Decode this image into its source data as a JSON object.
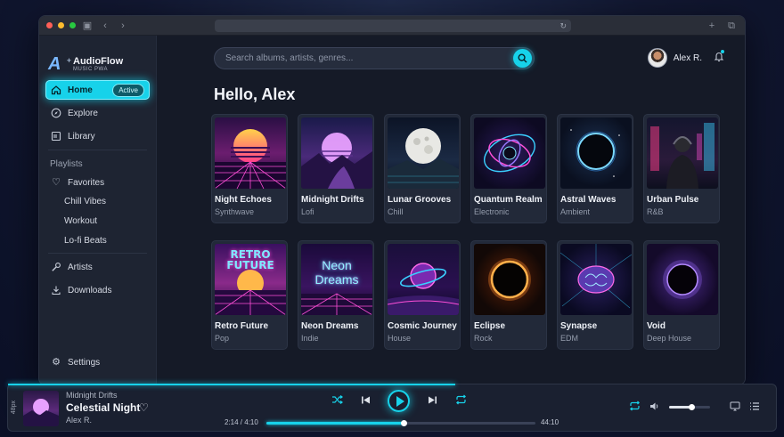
{
  "app": {
    "brand_name": "AudioFlow",
    "brand_sub": "MUSIC PWA",
    "accent_color": "#17d2ea"
  },
  "sidebar": {
    "nav": [
      {
        "label": "Home",
        "icon": "home-icon",
        "badge": "Active"
      },
      {
        "label": "Explore",
        "icon": "compass-icon"
      },
      {
        "label": "Library",
        "icon": "library-icon"
      }
    ],
    "playlists_label": "Playlists",
    "favorites_label": "Favorites",
    "playlists": [
      "Chill Vibes",
      "Workout",
      "Lo-fi Beats"
    ],
    "artists_label": "Artists",
    "downloads_label": "Downloads",
    "settings_label": "Settings"
  },
  "header": {
    "search_placeholder": "Search albums, artists, genres...",
    "user_name": "Alex R.",
    "greeting": "Hello, Alex"
  },
  "albums": [
    {
      "title": "Night Echoes",
      "genre": "Synthwave"
    },
    {
      "title": "Midnight Drifts",
      "genre": "Lofi"
    },
    {
      "title": "Lunar Grooves",
      "genre": "Chill"
    },
    {
      "title": "Quantum Realm",
      "genre": "Electronic"
    },
    {
      "title": "Astral Waves",
      "genre": "Ambient"
    },
    {
      "title": "Urban Pulse",
      "genre": "R&B"
    },
    {
      "title": "Retro Future",
      "genre": "Pop",
      "art_text": [
        "RETRO",
        "FUTURE"
      ]
    },
    {
      "title": "Neon Dreams",
      "genre": "Indie",
      "art_text": [
        "Neon",
        "Dreams"
      ]
    },
    {
      "title": "Cosmic Journey",
      "genre": "House"
    },
    {
      "title": "Eclipse",
      "genre": "Rock"
    },
    {
      "title": "Synapse",
      "genre": "EDM"
    },
    {
      "title": "Void",
      "genre": "Deep House"
    }
  ],
  "player": {
    "side_tag": "48px",
    "album": "Midnight Drifts",
    "track": "Celestial Night",
    "artist": "Alex R.",
    "elapsed": "2:14 / 4:10",
    "total": "44:10",
    "progress": 0.51,
    "volume": 0.55
  }
}
